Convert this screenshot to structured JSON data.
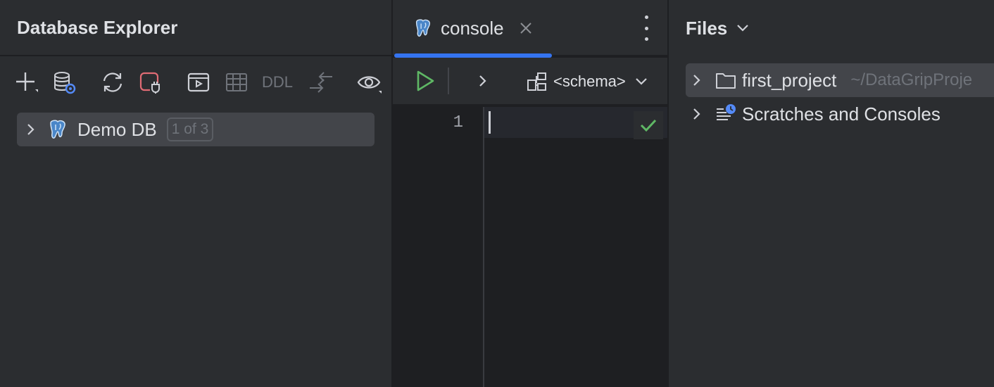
{
  "explorer": {
    "title": "Database Explorer",
    "toolbar": {
      "ddl_label": "DDL"
    },
    "tree": [
      {
        "label": "Demo DB",
        "badge": "1 of 3",
        "icon": "postgresql-elephant-icon"
      }
    ]
  },
  "console": {
    "tab_label": "console",
    "tab_icon": "postgresql-elephant-icon",
    "schema_label": "<schema>",
    "line_number": "1"
  },
  "files": {
    "title": "Files",
    "items": [
      {
        "label": "first_project",
        "path": "~/DataGripProje"
      },
      {
        "label": "Scratches and Consoles"
      }
    ]
  },
  "colors": {
    "accent": "#3574f0",
    "run_green": "#5fb865",
    "check_green": "#5fb865",
    "disconnect_red": "#e06c75"
  }
}
